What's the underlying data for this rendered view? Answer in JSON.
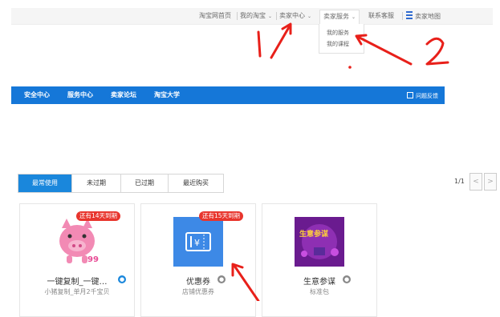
{
  "topnav": {
    "home": "淘宝网首页",
    "my_taobao": "我的淘宝",
    "seller_center": "卖家中心",
    "seller_services": "卖家服务",
    "contact_service": "联系客服",
    "seller_map": "卖家地图"
  },
  "dropdown": {
    "items": [
      "我的服务",
      "我的课程"
    ]
  },
  "bluebar": {
    "links": [
      "安全中心",
      "服务中心",
      "卖家论坛",
      "淘宝大学"
    ],
    "feedback": "问题反馈"
  },
  "tabs": [
    "最常使用",
    "未过期",
    "已过期",
    "最近购买"
  ],
  "pager": {
    "text": "1/1",
    "prev": "<",
    "next": ">"
  },
  "cards": [
    {
      "badge": "还有14天到期",
      "title": "一键复制_一键…",
      "subtitle": "小猪复制_单月2千宝贝"
    },
    {
      "badge": "还有15天到期",
      "title": "优惠券",
      "subtitle": "店铺优惠券"
    },
    {
      "badge": "",
      "title": "生意参谋",
      "subtitle": "标准包"
    }
  ],
  "annotations": [
    "1",
    "2"
  ],
  "colors": {
    "accent_blue": "#1577d8",
    "badge_red": "#e8352d",
    "annotation_red": "#e8201a"
  }
}
